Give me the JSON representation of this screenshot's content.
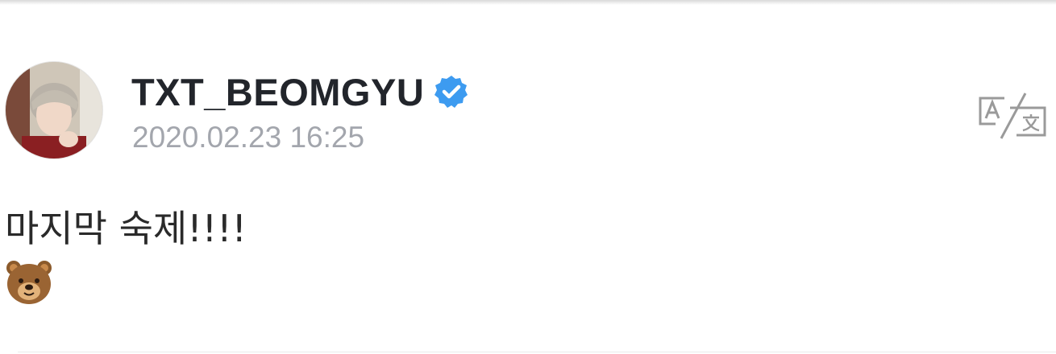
{
  "post": {
    "username": "TXT_BEOMGYU",
    "verified": true,
    "timestamp": "2020.02.23 16:25",
    "text": "마지막 숙제!!!!",
    "emoji": "bear-face",
    "translate_icon": "translate-icon"
  },
  "colors": {
    "username": "#22252b",
    "timestamp": "#a3a6ad",
    "verified_badge": "#3d9bf0",
    "translate_icon": "#9a9a9a"
  }
}
